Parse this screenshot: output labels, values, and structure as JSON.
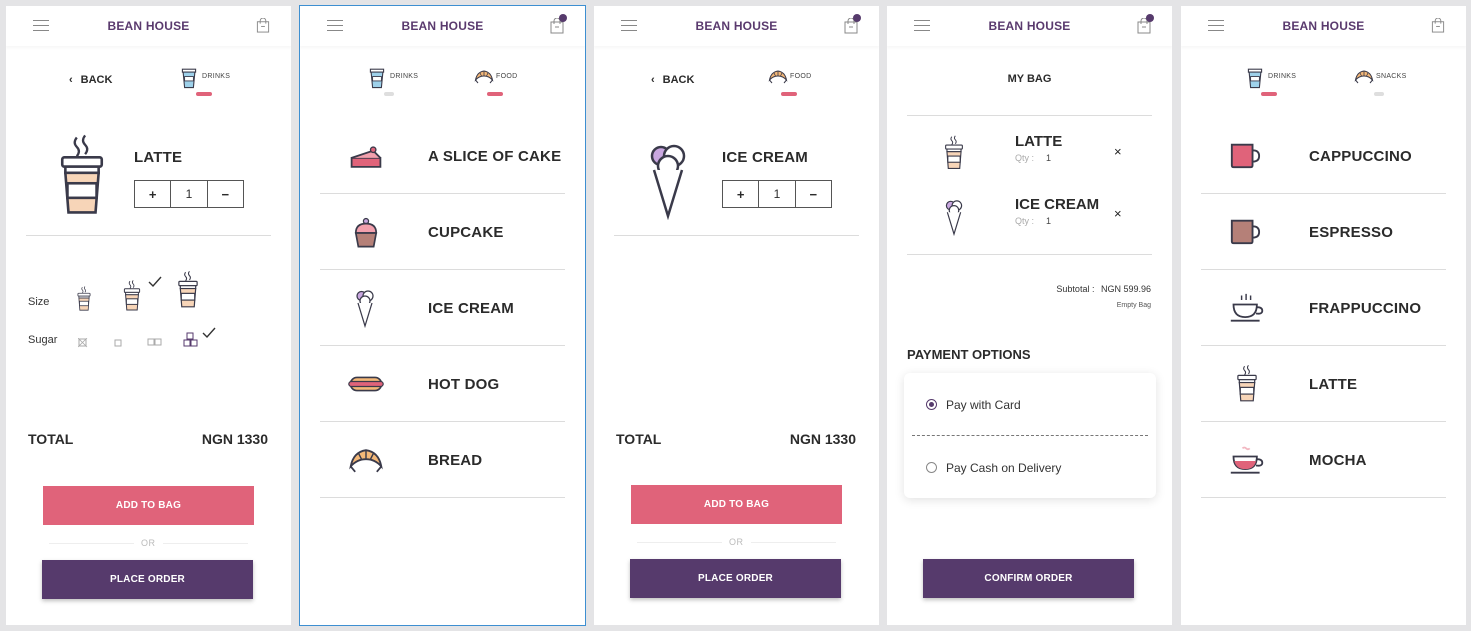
{
  "app_title": "BEAN HOUSE",
  "or_text": "OR",
  "add_to_bag_label": "ADD TO BAG",
  "place_order_label": "PLACE ORDER",
  "confirm_order_label": "CONFIRM ORDER",
  "back_label": "BACK",
  "total_label": "TOTAL",
  "screen1": {
    "tab": "DRINKS",
    "product": "LATTE",
    "qty": "1",
    "plus": "+",
    "minus": "−",
    "size_label": "Size",
    "sugar_label": "Sugar",
    "total_value": "NGN 1330"
  },
  "screen2": {
    "tabs": [
      "DRINKS",
      "FOOD"
    ],
    "items": [
      "A SLICE OF CAKE",
      "CUPCAKE",
      "ICE CREAM",
      "HOT DOG",
      "BREAD"
    ]
  },
  "screen3": {
    "tab": "FOOD",
    "product": "ICE CREAM",
    "qty": "1",
    "plus": "+",
    "minus": "−",
    "total_value": "NGN 1330"
  },
  "screen4": {
    "title": "MY BAG",
    "items": [
      {
        "name": "LATTE",
        "qty_label": "Qty :",
        "qty": "1"
      },
      {
        "name": "ICE CREAM",
        "qty_label": "Qty :",
        "qty": "1"
      }
    ],
    "remove_symbol": "×",
    "subtotal_label": "Subtotal :",
    "subtotal_value": "NGN 599.96",
    "empty_bag": "Empty Bag",
    "payment_title": "PAYMENT OPTIONS",
    "pay_card": "Pay with Card",
    "pay_cash": "Pay Cash on Delivery"
  },
  "screen5": {
    "tabs": [
      "DRINKS",
      "SNACKS"
    ],
    "items": [
      "CAPPUCCINO",
      "ESPRESSO",
      "FRAPPUCCINO",
      "LATTE",
      "MOCHA"
    ]
  },
  "colors": {
    "accent_pink": "#e0637a",
    "accent_purple": "#563a6c",
    "title_purple": "#5a3a6e"
  }
}
